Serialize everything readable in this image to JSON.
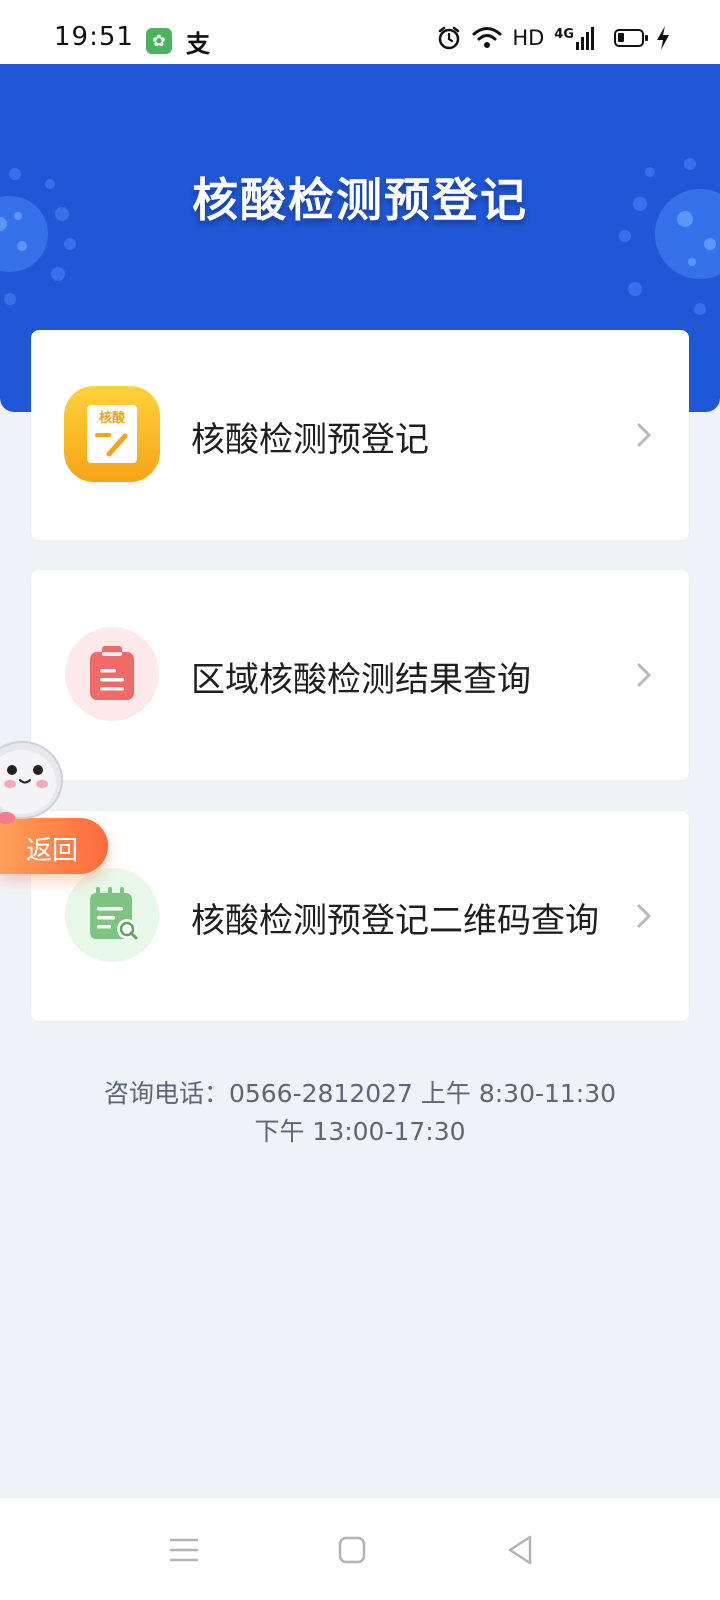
{
  "status_bar": {
    "time": "19:51",
    "app_badge_glyph": "✿",
    "app_badge_icon": "app-notification-icon",
    "alipay_glyph": "支",
    "hd_label": "HD",
    "network_label": "4G",
    "icons": [
      "alarm-icon",
      "wifi-icon",
      "signal-icon",
      "battery-icon",
      "charging-icon"
    ]
  },
  "header": {
    "title": "核酸检测预登记",
    "background_color": "#2057d6"
  },
  "menu": {
    "items": [
      {
        "label": "核酸检测预登记",
        "icon": "registration-icon",
        "icon_text": "核酸",
        "icon_color": "#fbb21c"
      },
      {
        "label": "区域核酸检测结果查询",
        "icon": "clipboard-icon",
        "icon_color": "#f06a6a"
      },
      {
        "label": "核酸检测预登记二维码查询",
        "icon": "qrcode-search-icon",
        "icon_color": "#7cc480"
      }
    ]
  },
  "footer": {
    "line1": "咨询电话：0566-2812027 上午 8:30-11:30",
    "line2": "下午 13:00-17:30"
  },
  "float_back": {
    "label": "返回",
    "icon": "mascot-icon"
  },
  "nav_bar": {
    "icons": [
      "menu-icon",
      "home-icon",
      "back-icon"
    ]
  },
  "colors": {
    "page_background": "#eff2f6",
    "card_background": "#ffffff",
    "back_button": "#ff7a45"
  }
}
